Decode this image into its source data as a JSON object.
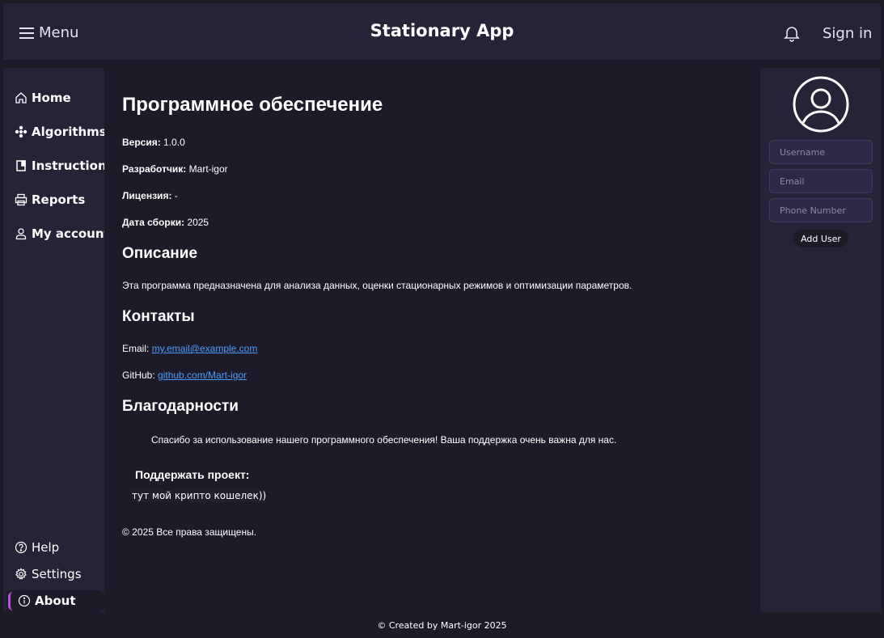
{
  "header": {
    "menu_label": "Menu",
    "app_title": "Stationary App",
    "sign_in_label": "Sign in"
  },
  "sidebar": {
    "items": [
      {
        "label": "Home",
        "icon": "home-icon"
      },
      {
        "label": "Algorithms",
        "icon": "snowflake-icon"
      },
      {
        "label": "Instructions",
        "icon": "book-icon"
      },
      {
        "label": "Reports",
        "icon": "printer-icon"
      },
      {
        "label": "My account",
        "icon": "user-icon"
      }
    ],
    "bottom_items": [
      {
        "label": "Help",
        "icon": "question-icon"
      },
      {
        "label": "Settings",
        "icon": "gear-icon"
      },
      {
        "label": "About",
        "icon": "info-icon",
        "active": true
      }
    ],
    "active_color": "#c04fd6"
  },
  "main": {
    "title": "Программное обеспечение",
    "version_label": "Версия:",
    "version_value": " 1.0.0",
    "developer_label": "Разработчик:",
    "developer_value": " Mart-igor",
    "license_label": "Лицензия:",
    "license_value": " -",
    "build_label": "Дата сборки:",
    "build_value": " 2025",
    "description_heading": "Описание",
    "description_text": "Эта программа предназначена для анализа данных, оценки стационарных режимов и оптимизации параметров.",
    "contacts_heading": "Контакты",
    "email_label": "Email: ",
    "email_link": "my.email@example.com",
    "github_label": "GitHub: ",
    "github_link": "github.com/Mart-igor",
    "thanks_heading": "Благодарности",
    "thanks_text": "Спасибо за использование нашего программного обеспечения! Ваша поддержка очень важна для нас.",
    "support_title": "Поддержать проект:",
    "support_text": "тут мой крипто кошелек))",
    "copyright": "© 2025 Все права защищены."
  },
  "right_panel": {
    "username_placeholder": "Username",
    "email_placeholder": "Email",
    "phone_placeholder": "Phone Number",
    "add_user_label": "Add User"
  },
  "footer": {
    "text": "© Created by Mart-igor 2025"
  },
  "colors": {
    "background": "#1c1b27",
    "panel": "#262339",
    "link": "#4a9eff",
    "accent": "#c04fd6"
  }
}
